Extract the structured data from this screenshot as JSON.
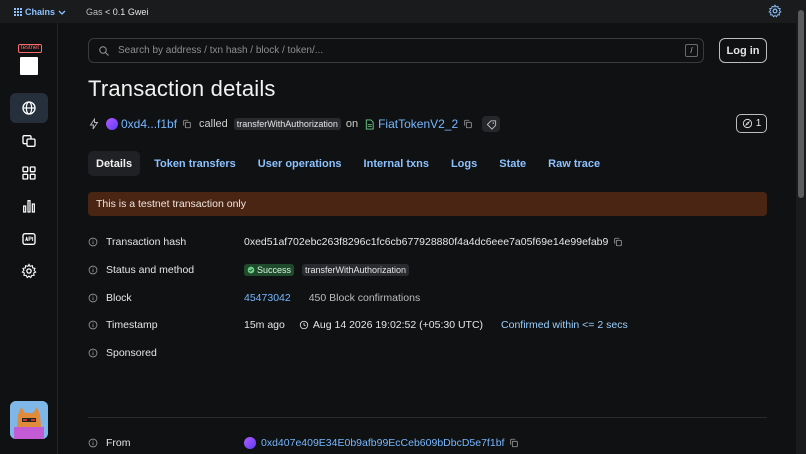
{
  "topbar": {
    "chains_label": "Chains",
    "gas_label": "Gas",
    "gas_value": "< 0.1 Gwei"
  },
  "sidebar": {
    "testnet_badge": "testnet"
  },
  "search": {
    "placeholder": "Search by address / txn hash / block / token/...",
    "shortcut": "/"
  },
  "login_label": "Log in",
  "page": {
    "title": "Transaction details",
    "from_short": "0xd4...f1bf",
    "called": "called",
    "method": "transferWithAuthorization",
    "on": "on",
    "contract": "FiatTokenV2_2",
    "counter": "1"
  },
  "tabs": [
    "Details",
    "Token transfers",
    "User operations",
    "Internal txns",
    "Logs",
    "State",
    "Raw trace"
  ],
  "banner": "This is a testnet transaction only",
  "details": {
    "hash_label": "Transaction hash",
    "hash": "0xed51af702ebc263f8296c1fc6cb677928880f4a4dc6eee7a05f69e14e99efab9",
    "status_label": "Status and method",
    "status": "Success",
    "method": "transferWithAuthorization",
    "block_label": "Block",
    "block": "45473042",
    "confirmations": "450 Block confirmations",
    "timestamp_label": "Timestamp",
    "ago": "15m ago",
    "datetime": "Aug 14 2026 19:02:52 (+05:30 UTC)",
    "confirmed_within": "Confirmed within <= 2 secs",
    "sponsored_label": "Sponsored",
    "from_label": "From",
    "from": "0xd407e409E34E0b9afb99EcCeb609bDbcD5e7f1bf"
  },
  "colors": {
    "accent": "#8cc2ff",
    "banner_bg": "#4b2514",
    "success_bg": "#1f4a2c"
  }
}
